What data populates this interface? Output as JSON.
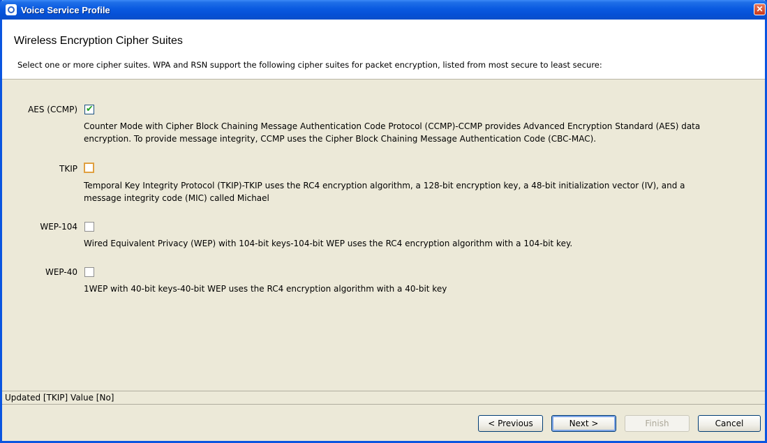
{
  "window": {
    "title": "Voice Service Profile",
    "close_glyph": "✕"
  },
  "header": {
    "heading": "Wireless Encryption Cipher Suites",
    "subheading": "Select one or more cipher suites. WPA and RSN support the following cipher suites for packet encryption, listed from most secure to least secure:"
  },
  "suites": [
    {
      "label": "AES (CCMP)",
      "checked": true,
      "check_glyph": "✔",
      "desc_line1": "Counter Mode with Cipher Block Chaining Message Authentication Code Protocol (CCMP)-CCMP provides Advanced Encryption Standard (AES) data",
      "desc_line2": "encryption. To provide message  integrity, CCMP uses the Cipher Block Chaining Message  Authentication Code (CBC-MAC)."
    },
    {
      "label": "TKIP",
      "checked": false,
      "desc_line1": "Temporal Key Integrity Protocol (TKIP)-TKIP uses the RC4 encryption algorithm, a 128-bit encryption key, a 48-bit initialization vector (IV), and a",
      "desc_line2": "message integrity code (MIC) called Michael"
    },
    {
      "label": "WEP-104",
      "checked": false,
      "desc_line1": "Wired Equivalent Privacy (WEP) with 104-bit keys-104-bit WEP uses the RC4 encryption algorithm with a 104-bit key."
    },
    {
      "label": "WEP-40",
      "checked": false,
      "desc_line1": "1WEP with 40-bit keys-40-bit WEP uses the RC4 encryption algorithm with a 40-bit key"
    }
  ],
  "status": {
    "text": "Updated [TKIP] Value [No]"
  },
  "buttons": {
    "previous": "< Previous",
    "next": "Next >",
    "finish": "Finish",
    "cancel": "Cancel"
  },
  "colors": {
    "titlebar": "#0a5ae0",
    "check": "#21a121",
    "focus_ring": "#e0a040"
  }
}
